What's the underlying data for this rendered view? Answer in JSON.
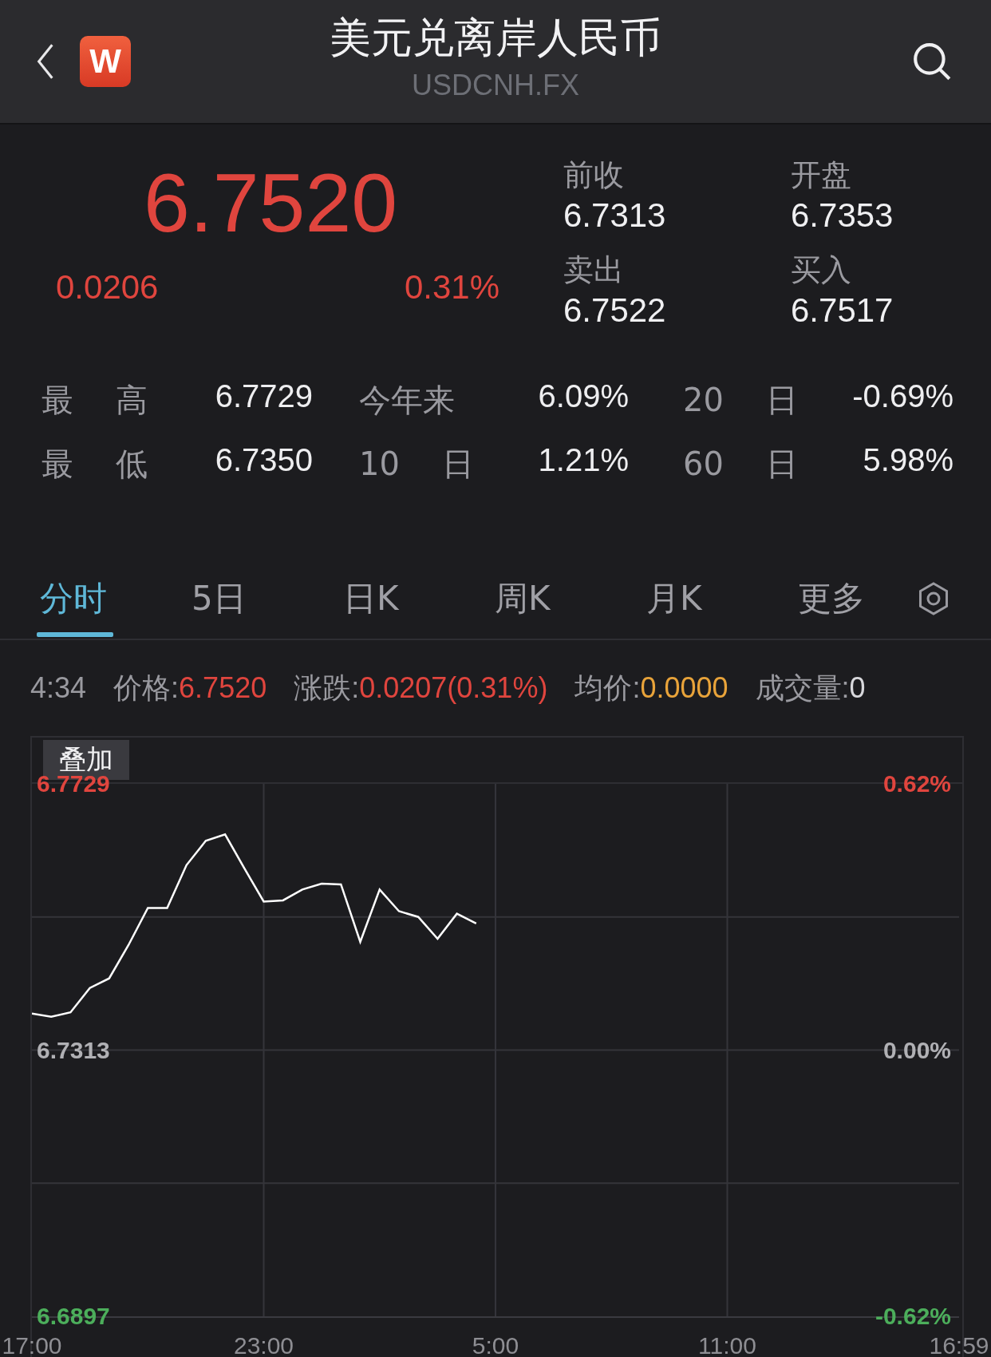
{
  "header": {
    "logo_text": "W",
    "title": "美元兑离岸人民币",
    "subtitle": "USDCNH.FX"
  },
  "quote": {
    "price": "6.7520",
    "change": "0.0206",
    "change_pct": "0.31%",
    "color": "#e0453e"
  },
  "book": [
    {
      "label": "前收",
      "value": "6.7313"
    },
    {
      "label": "开盘",
      "value": "6.7353"
    },
    {
      "label": "卖出",
      "value": "6.7522"
    },
    {
      "label": "买入",
      "value": "6.7517"
    }
  ],
  "stats": [
    [
      {
        "label": "最 高",
        "value": "6.7729"
      },
      {
        "label": "今年来",
        "value": "6.09%"
      },
      {
        "label": "20 日",
        "value": "-0.69%"
      }
    ],
    [
      {
        "label": "最 低",
        "value": "6.7350"
      },
      {
        "label": "10 日",
        "value": "1.21%"
      },
      {
        "label": "60 日",
        "value": "5.98%"
      }
    ]
  ],
  "tabs": [
    {
      "label": "分时",
      "selected": true
    },
    {
      "label": "5日",
      "selected": false
    },
    {
      "label": "日K",
      "selected": false
    },
    {
      "label": "周K",
      "selected": false
    },
    {
      "label": "月K",
      "selected": false
    },
    {
      "label": "更多",
      "selected": false
    }
  ],
  "info": {
    "time": "4:34",
    "fields": [
      {
        "label": "价格:",
        "value": "6.7520",
        "color": "#e0453e"
      },
      {
        "label": "涨跌:",
        "value": "0.0207(0.31%)",
        "color": "#e0453e"
      },
      {
        "label": "均价:",
        "value": "0.0000",
        "color": "#e8a33a"
      },
      {
        "label": "成交量:",
        "value": "0",
        "color": "#d8d8dc"
      }
    ]
  },
  "chart": {
    "overlay_button": "叠加",
    "right_labels": [
      {
        "label": "0.62%",
        "color": "#e0453e"
      },
      {
        "label": "0.00%",
        "color": "#b0b0b4"
      },
      {
        "label": "-0.62%",
        "color": "#4cae5b"
      }
    ],
    "chart_data": {
      "type": "line",
      "ylim": [
        6.6897,
        6.7729
      ],
      "categories": [
        "17:00",
        null,
        null,
        null,
        null,
        null,
        null,
        null,
        null,
        null,
        null,
        null,
        "23:00",
        null,
        null,
        null,
        null,
        null,
        null,
        null,
        null,
        null,
        null,
        null,
        "5:00",
        null,
        null,
        null,
        null,
        null,
        null,
        null,
        null,
        null,
        null,
        null,
        "11:00",
        null,
        null,
        null,
        null,
        null,
        null,
        null,
        null,
        null,
        null,
        null,
        "16:59"
      ],
      "yticks": [
        6.7729,
        6.7313,
        6.6897
      ],
      "grid": true,
      "series": [
        {
          "color": "#ffffff",
          "values": [
            6.737,
            6.7365,
            6.7372,
            6.741,
            6.7425,
            6.7477,
            6.7535,
            6.7535,
            6.7602,
            6.764,
            6.765,
            6.7597,
            6.7545,
            6.7547,
            6.7564,
            6.7573,
            6.7572,
            6.7482,
            6.7564,
            6.753,
            6.7521,
            6.7487,
            6.7526,
            6.7511,
            null,
            null,
            null,
            null,
            null,
            null,
            null,
            null,
            null,
            null,
            null,
            null,
            null,
            null,
            null,
            null,
            null,
            null,
            null,
            null,
            null,
            null,
            null,
            null,
            null
          ]
        }
      ]
    }
  }
}
